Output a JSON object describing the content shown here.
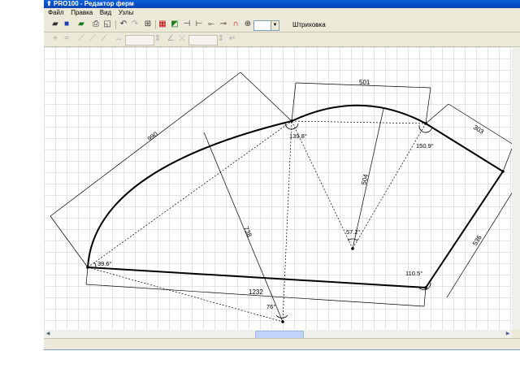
{
  "window": {
    "title": "PRO100 - Редактор ферм"
  },
  "menu": [
    "Файл",
    "Правка",
    "Вид",
    "Узлы"
  ],
  "toolbar": {
    "hatch_label": "Штриховка",
    "zoom_value": ""
  },
  "drawing": {
    "dimensions": {
      "left_arc": "990",
      "top_arc": "501",
      "right_top": "303",
      "right_side": "536",
      "bottom": "1232",
      "chord": "738",
      "radius": "504"
    },
    "angles": {
      "left": "39.6°",
      "top": "139.8°",
      "right_top": "150.9°",
      "bottom_right": "110.5°",
      "center": "57.2°",
      "bottom_apex": "76°"
    }
  }
}
